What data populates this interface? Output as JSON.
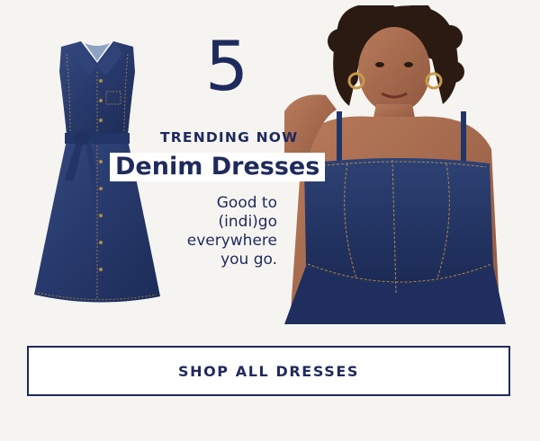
{
  "promo": {
    "number": "5",
    "eyebrow": "TRENDING NOW",
    "title": "Denim Dresses",
    "tagline_lines": [
      "Good to",
      "(indi)go",
      "everywhere",
      "you go."
    ]
  },
  "cta": {
    "label": "SHOP ALL DRESSES"
  },
  "colors": {
    "background": "#f6f4f1",
    "navy": "#1f2a5c",
    "denim": "#2b3f73",
    "stitch": "#b08a4a"
  },
  "images": {
    "product": "sleeveless-belted-denim-shirt-dress-icon",
    "model": "model-in-denim-corset-sundress-icon"
  }
}
